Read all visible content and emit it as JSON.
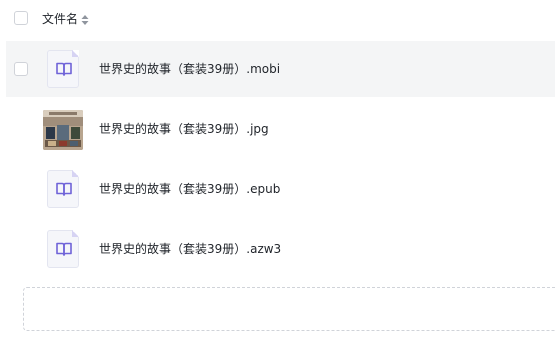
{
  "table": {
    "header": {
      "name_label": "文件名"
    },
    "rows": [
      {
        "name": "世界史的故事（套装39册）.mobi",
        "type": "ebook",
        "icon": "book-icon",
        "hovered": true
      },
      {
        "name": "世界史的故事（套装39册）.jpg",
        "type": "image",
        "icon": "image-thumbnail",
        "hovered": false
      },
      {
        "name": "世界史的故事（套装39册）.epub",
        "type": "ebook",
        "icon": "book-icon",
        "hovered": false
      },
      {
        "name": "世界史的故事（套装39册）.azw3",
        "type": "ebook",
        "icon": "book-icon",
        "hovered": false
      }
    ]
  },
  "colors": {
    "accent": "#6f63d8",
    "hover_row": "#f4f5f6",
    "border": "#d0d3d9"
  }
}
